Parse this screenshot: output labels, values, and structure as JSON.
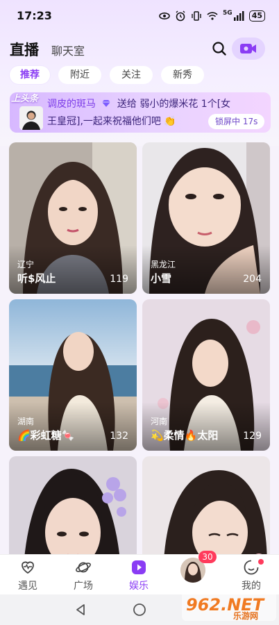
{
  "status_bar": {
    "time": "17:23",
    "network": "5G",
    "battery": "45"
  },
  "header": {
    "title": "直播",
    "subtitle": "聊天室"
  },
  "tabs": [
    {
      "label": "推荐",
      "active": true
    },
    {
      "label": "附近",
      "active": false
    },
    {
      "label": "关注",
      "active": false
    },
    {
      "label": "新秀",
      "active": false
    }
  ],
  "banner": {
    "tag": "上头条",
    "line1_sender": "调皮的斑马",
    "line1_rest": "送给 弱小的爆米花 1个[女",
    "line2": "王皇冠],一起来祝福他们吧",
    "lock_label": "锁屏中 17s"
  },
  "cards": [
    {
      "province": "辽宁",
      "nickname": "听$风止",
      "count": "119"
    },
    {
      "province": "黑龙江",
      "nickname": "小雪",
      "count": "204"
    },
    {
      "province": "湖南",
      "nickname": "🌈彩虹糖🍬",
      "count": "132"
    },
    {
      "province": "河南",
      "nickname": "💫柔情🔥太阳",
      "count": "129"
    },
    {
      "province": "",
      "nickname": "",
      "count": ""
    },
    {
      "province": "",
      "nickname": "",
      "count": ""
    }
  ],
  "bottom_nav": {
    "items": [
      {
        "label": "遇见",
        "icon": "heart-pulse-icon",
        "active": false
      },
      {
        "label": "广场",
        "icon": "planet-icon",
        "active": false
      },
      {
        "label": "娱乐",
        "icon": "play-icon",
        "active": true
      },
      {
        "label": "",
        "icon": "avatar",
        "active": false
      },
      {
        "label": "我的",
        "icon": "smile-icon",
        "active": false
      }
    ],
    "message_badge": "30"
  },
  "watermark": {
    "main": "962.NET",
    "sub": "乐游网"
  },
  "colors": {
    "accent": "#8a3cf4",
    "badge": "#ff3b5c"
  }
}
